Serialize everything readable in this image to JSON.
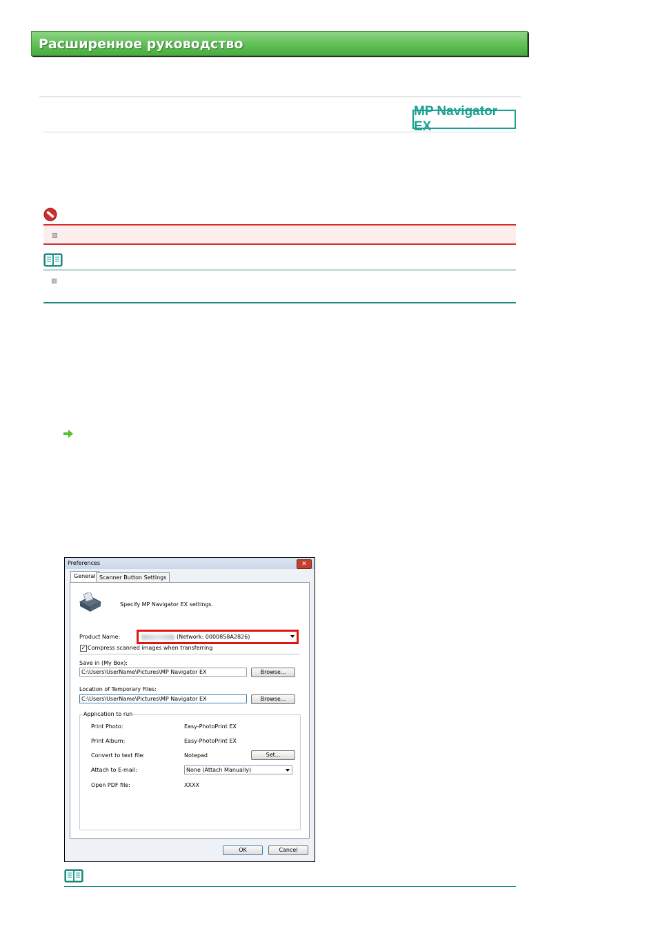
{
  "header": {
    "title": "Расширенное руководство"
  },
  "badge": {
    "label": "MP Navigator EX"
  },
  "colors": {
    "banner_green": "#5fbf55",
    "accent_teal": "#18a090",
    "important_red": "#d82b2b",
    "note_line": "#1b8a80"
  },
  "dialog": {
    "title": "Preferences",
    "close_label": "✕",
    "tabs": [
      {
        "label": "General"
      },
      {
        "label": "Scanner Button Settings"
      }
    ],
    "description": "Specify MP Navigator EX settings.",
    "product_name_label": "Product Name:",
    "product_name_value": "(Network: 0000858A2826)",
    "compress_label": "Compress scanned images when transferring",
    "compress_checked": true,
    "save_in_label": "Save in (My Box):",
    "save_in_value": "C:\\Users\\UserName\\Pictures\\MP Navigator EX",
    "temp_files_label": "Location of Temporary Files:",
    "temp_files_value": "C:\\Users\\UserName\\Pictures\\MP Navigator EX",
    "browse_label": "Browse...",
    "app_group_label": "Application to run",
    "print_photo_label": "Print Photo:",
    "print_photo_value": "Easy-PhotoPrint EX",
    "print_album_label": "Print Album:",
    "print_album_value": "Easy-PhotoPrint EX",
    "convert_text_label": "Convert to text file:",
    "convert_text_value": "Notepad",
    "set_label": "Set...",
    "attach_email_label": "Attach to E-mail:",
    "attach_email_value": "None (Attach Manually)",
    "open_pdf_label": "Open PDF file:",
    "open_pdf_value": "XXXX",
    "ok_label": "OK",
    "cancel_label": "Cancel"
  }
}
